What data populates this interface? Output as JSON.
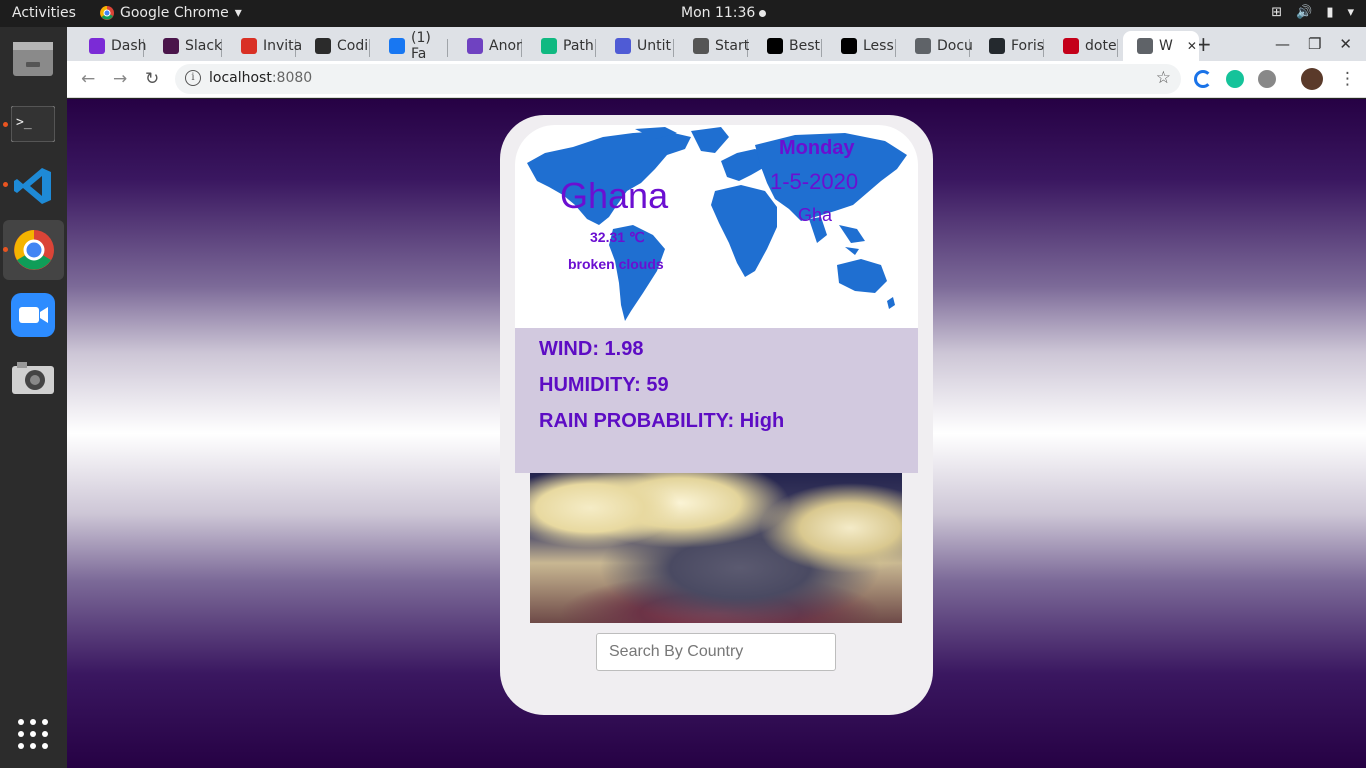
{
  "topbar": {
    "activities": "Activities",
    "app_name": "Google Chrome",
    "clock": "Mon 11:36"
  },
  "browser": {
    "tabs": [
      {
        "label": "Dash",
        "icon_color": "#7b2bd6"
      },
      {
        "label": "Slack",
        "icon_color": "#4a154b"
      },
      {
        "label": "Invita",
        "icon_color": "#d93025"
      },
      {
        "label": "Codi",
        "icon_color": "#2b2b2b"
      },
      {
        "label": "(1) Fa",
        "icon_color": "#1877f2"
      },
      {
        "label": "Anor",
        "icon_color": "#6f42c1"
      },
      {
        "label": "Path",
        "icon_color": "#10b981"
      },
      {
        "label": "Untit",
        "icon_color": "#4f5bd5"
      },
      {
        "label": "Start",
        "icon_color": "#555555"
      },
      {
        "label": "Best",
        "icon_color": "#000000"
      },
      {
        "label": "Less",
        "icon_color": "#000000"
      },
      {
        "label": "Docu",
        "icon_color": "#5f6368"
      },
      {
        "label": "Foris",
        "icon_color": "#24292e"
      },
      {
        "label": "dote",
        "icon_color": "#c4001a"
      },
      {
        "label": "W",
        "icon_color": "#5f6368"
      }
    ],
    "url_host": "localhost",
    "url_port": ":8080"
  },
  "weather": {
    "country": "Ghana",
    "temperature": "32.31 ℃",
    "description": "broken clouds",
    "day": "Monday",
    "date": "1-5-2020",
    "country_code": "Gha",
    "wind": "WIND: 1.98",
    "humidity": "HUMIDITY: 59",
    "rain": "RAIN PROBABILITY: High",
    "search_placeholder": "Search By Country"
  },
  "colors": {
    "accent_purple": "#6b0fd1",
    "map_blue": "#1f6fd1",
    "stats_panel": "#d2c9df",
    "background_dark": "#260144"
  }
}
